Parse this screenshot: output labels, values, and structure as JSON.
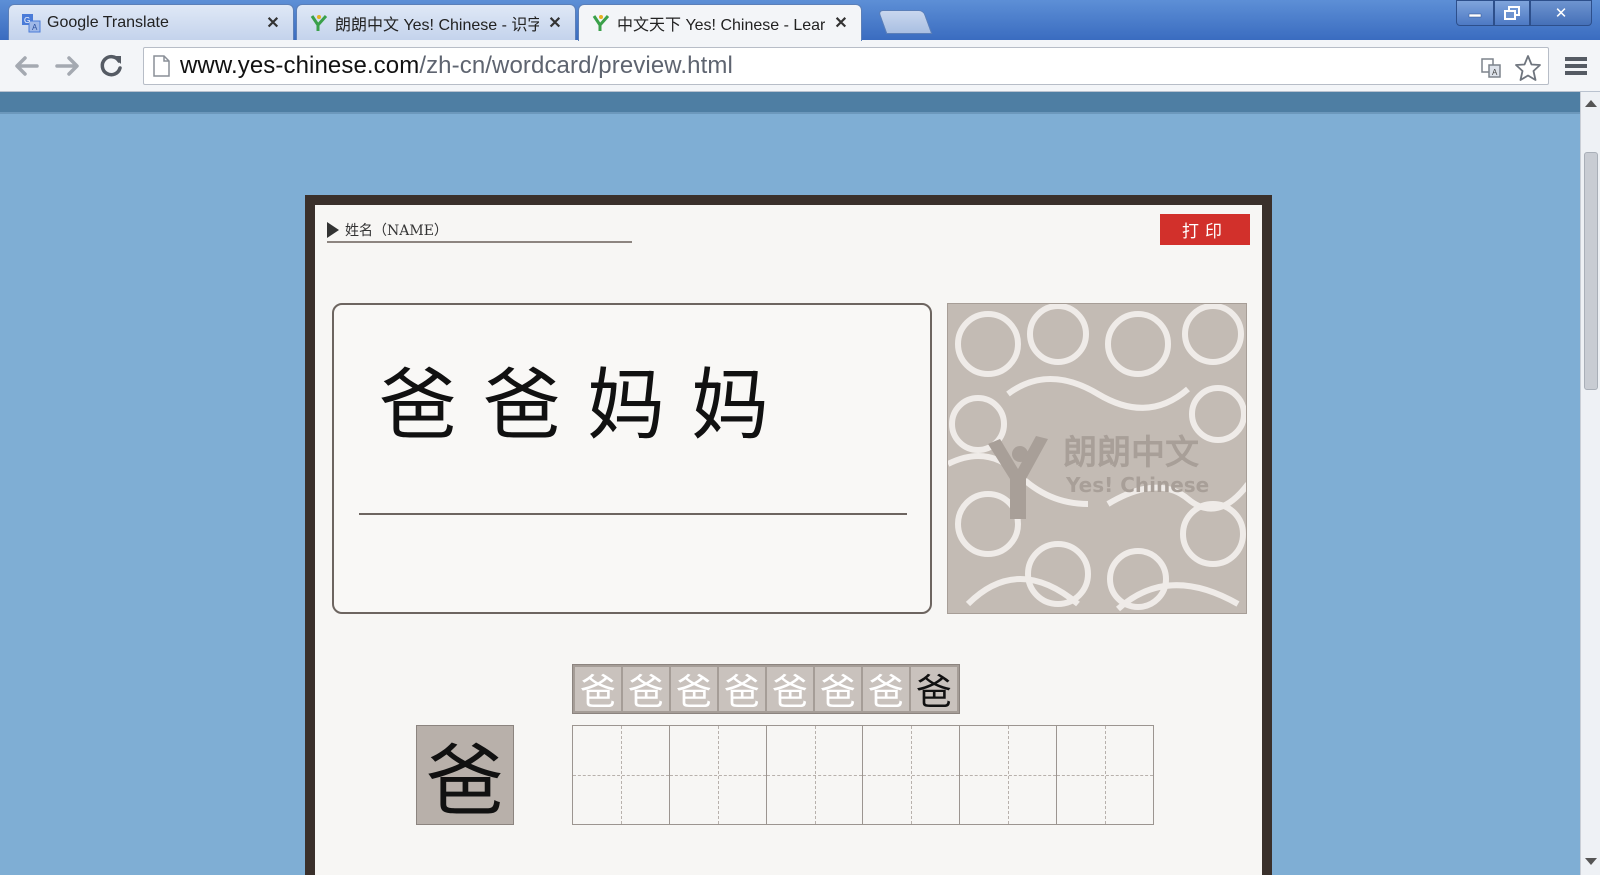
{
  "browser": {
    "tabs": [
      {
        "title": "Google Translate",
        "icon": "google-translate-icon",
        "active": false
      },
      {
        "title": "朗朗中文 Yes! Chinese - 识字",
        "icon": "yes-chinese-icon",
        "active": false
      },
      {
        "title": "中文天下 Yes! Chinese - Lear",
        "icon": "yes-chinese-icon",
        "active": true
      }
    ],
    "close_glyph": "✕",
    "url_domain": "www.yes-chinese.com",
    "url_path": "/zh-cn/wordcard/preview.html"
  },
  "card": {
    "name_label": "姓名（NAME）",
    "print_label": "打印",
    "word": "爸爸妈妈",
    "logo_cn": "朗朗中文",
    "logo_en": "Yes! Chinese",
    "stroke_steps": [
      "爸",
      "爸",
      "爸",
      "爸",
      "爸",
      "爸",
      "爸",
      "爸"
    ],
    "sample_char": "爸",
    "grid_cells": 6
  },
  "colors": {
    "page_bg": "#7faed4",
    "frame": "#3a302b",
    "print_button": "#d2302b"
  }
}
